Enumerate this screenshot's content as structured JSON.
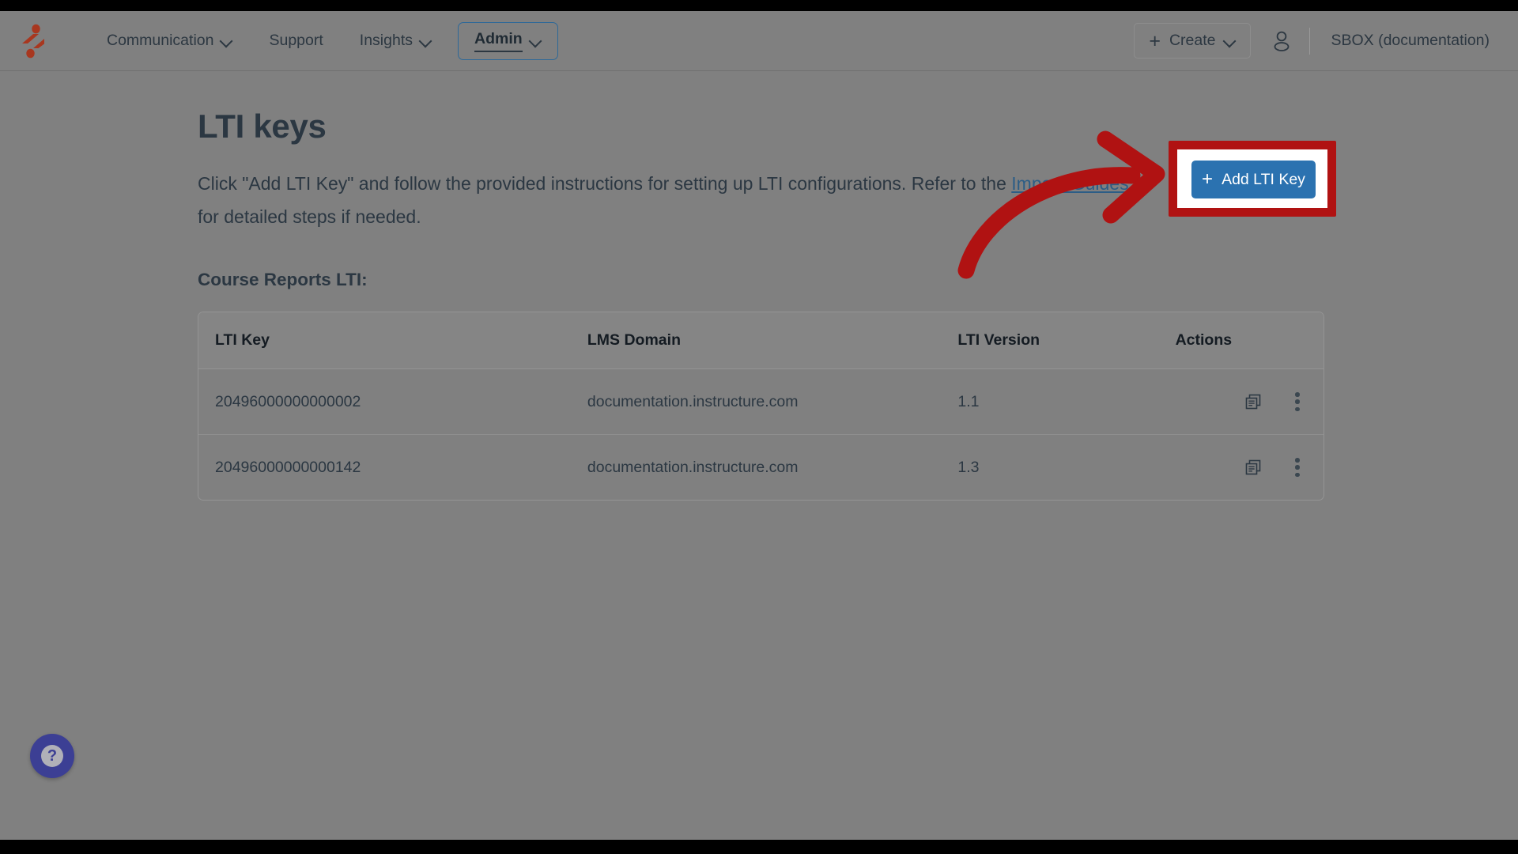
{
  "app": {
    "logo_icon": "impact-logo-icon",
    "account_name": "SBOX (documentation)"
  },
  "nav": {
    "items": [
      {
        "label": "Communication",
        "has_caret": true,
        "active": false
      },
      {
        "label": "Support",
        "has_caret": false,
        "active": false
      },
      {
        "label": "Insights",
        "has_caret": true,
        "active": false
      },
      {
        "label": "Admin",
        "has_caret": true,
        "active": true
      }
    ],
    "create_label": "Create",
    "create_icon": "plus-icon",
    "create_caret_icon": "chevron-down-icon",
    "user_icon": "user-account-icon"
  },
  "page": {
    "title": "LTI keys",
    "intro_part1": "Click \"Add LTI Key\" and follow the provided instructions for setting up LTI configurations. Refer to the ",
    "intro_link": "Impact Guides",
    "intro_part2": " for detailed steps if needed.",
    "section_title": "Course Reports LTI:"
  },
  "primary_action": {
    "label": "Add LTI Key",
    "icon": "plus-icon",
    "background_color": "#2b72b0",
    "text_color": "#ffffff",
    "highlight_color": "#b01212"
  },
  "annotation": {
    "arrow_icon": "curved-arrow-icon",
    "arrow_color": "#b01212"
  },
  "table": {
    "columns": [
      "LTI Key",
      "LMS Domain",
      "LTI Version",
      "Actions"
    ],
    "rows": [
      {
        "lti_key": "20496000000000002",
        "lms_domain": "documentation.instructure.com",
        "lti_version": "1.1",
        "copy_icon": "copy-icon",
        "menu_icon": "kebab-menu-icon"
      },
      {
        "lti_key": "20496000000000142",
        "lms_domain": "documentation.instructure.com",
        "lti_version": "1.3",
        "copy_icon": "copy-icon",
        "menu_icon": "kebab-menu-icon"
      }
    ]
  },
  "help": {
    "icon": "question-mark-icon",
    "label": "?",
    "color": "#3c3f94"
  }
}
